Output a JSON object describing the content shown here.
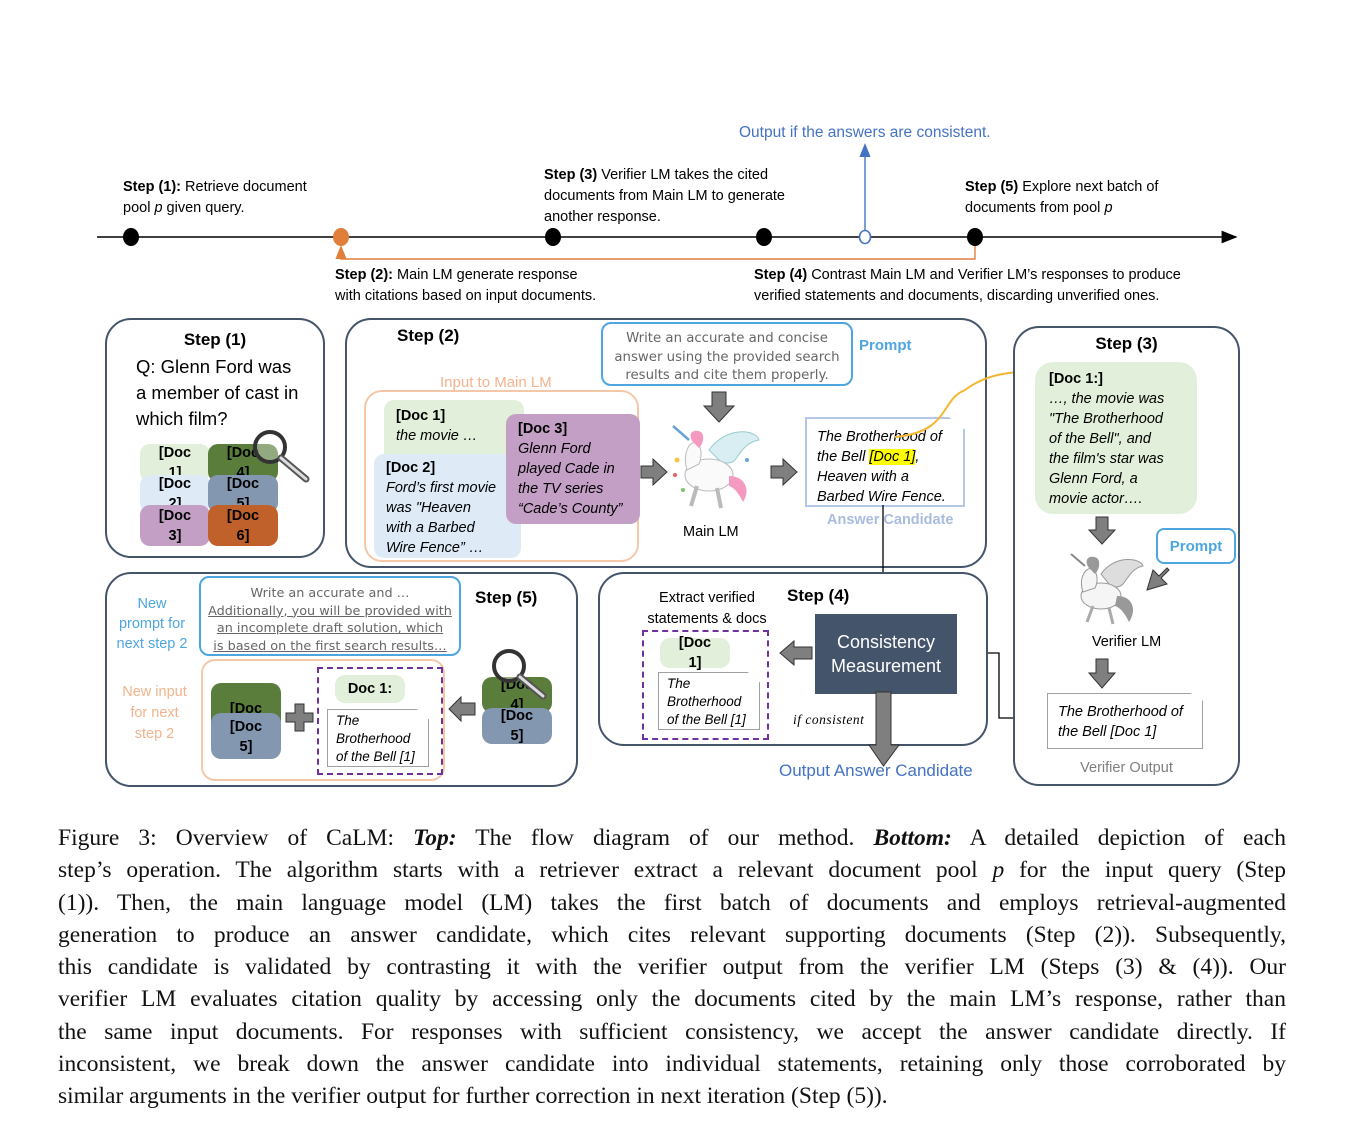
{
  "timeline": {
    "output_label": "Output if the answers are consistent.",
    "step1": {
      "bold": "Step (1):",
      "text": " Retrieve document",
      "line2a": "pool ",
      "line2p": "p",
      "line2b": " given query."
    },
    "step2": {
      "bold": "Step (2):",
      "text": " Main LM generate response",
      "line2": "with citations based on input documents."
    },
    "step3": {
      "bold": "Step (3)",
      "text": " Verifier LM takes the cited",
      "line2": "documents from Main LM to generate",
      "line3": "another response."
    },
    "step4": {
      "bold": "Step (4)",
      "text": " Contrast Main LM and Verifier LM’s responses to produce",
      "line2": "verified statements and documents, discarding unverified ones."
    },
    "step5": {
      "bold": "Step (5)",
      "text": " Explore next batch of",
      "line2a": "documents from pool ",
      "line2p": "p"
    },
    "colors": {
      "axis": "#000000",
      "step2_marker": "#e07f3c",
      "output_marker": "#4472c4",
      "feedback_line": "#e07f3c"
    }
  },
  "panel1": {
    "title": "Step (1)",
    "question": [
      "Q: Glenn Ford was",
      "a member of cast in",
      "which film?"
    ],
    "docs": [
      "[Doc 1]",
      "[Doc 2]",
      "[Doc 3]",
      "[Doc 4]",
      "[Doc 5]",
      "[Doc 6]"
    ],
    "doc_colors": [
      "#e2efda",
      "#deebf7",
      "#c39fc6",
      "#5a7d3c",
      "#8497b0",
      "#c0602a"
    ]
  },
  "panel2": {
    "title": "Step (2)",
    "input_label": "Input to Main LM",
    "doc1": {
      "tag": "[Doc 1]",
      "text": "the movie …"
    },
    "doc2": {
      "tag": "[Doc 2]",
      "lines": [
        "Ford’s first movie",
        "was \"Heaven",
        "with a Barbed",
        "Wire Fence” …"
      ]
    },
    "doc3": {
      "tag": "[Doc 3]",
      "lines": [
        "Glenn Ford",
        "played Cade in",
        "the TV series",
        "“Cade’s County”"
      ]
    },
    "prompt_lines": [
      "Write an accurate and concise",
      "answer using the provided search",
      "results and cite them properly."
    ],
    "prompt_label": "Prompt",
    "model_label": "Main LM",
    "answer": {
      "line1": "The Brotherhood of",
      "line2a": "the Bell ",
      "citation": "[Doc 1]",
      "line2b": ",",
      "line3": "Heaven with a",
      "line4": "Barbed Wire Fence."
    },
    "answer_label": "Answer Candidate"
  },
  "panel3": {
    "title": "Step (3)",
    "doc": {
      "tag": "[Doc 1:]",
      "lines": [
        "…, the movie was",
        "\"The Brotherhood",
        "of the Bell\", and",
        "the film's star was",
        "Glenn Ford, a",
        "movie actor…."
      ]
    },
    "prompt_label": "Prompt",
    "model_label": "Verifier LM",
    "output_lines": [
      "The Brotherhood of",
      "the Bell [Doc 1]"
    ],
    "output_label": "Verifier Output"
  },
  "panel4": {
    "title": "Step (4)",
    "extract_label": [
      "Extract verified",
      "statements & docs"
    ],
    "doc_tag": "[Doc 1]",
    "statement_lines": [
      "The",
      "Brotherhood",
      "of the Bell [1]"
    ],
    "measure_label": [
      "Consistency",
      "Measurement"
    ],
    "if_label": "if consistent",
    "output_label": "Output Answer Candidate"
  },
  "panel5": {
    "title": "Step (5)",
    "new_prompt_label": [
      "New",
      "prompt for",
      "next step 2"
    ],
    "prompt_lines": [
      "Write an accurate and …",
      "Additionally, you will be provided with",
      "an incomplete draft solution, which",
      "is based on the first search results…"
    ],
    "new_input_label": [
      "New input",
      "for next",
      "step 2"
    ],
    "docs_left": [
      "[Doc 4]",
      "[Doc 5]"
    ],
    "verified_tag": "Doc 1:",
    "verified_lines": [
      "The",
      "Brotherhood",
      "of the Bell [1]"
    ],
    "docs_right": [
      "[Doc 4]",
      "[Doc 5]"
    ]
  },
  "caption": {
    "lines": [
      [
        "Figure 3:  Overview of CaLM: ",
        "Top:",
        "  The flow diagram of our method.  ",
        "Bottom:",
        "  A detailed depiction of each"
      ],
      [
        "step’s operation. The algorithm starts with a retriever extract a relevant document pool ",
        "p",
        " for the input query (Step"
      ],
      [
        "(1)).  Then, the main language model (LM) takes the first batch of documents and employs retrieval-augmented"
      ],
      [
        "generation to produce an answer candidate, which cites relevant supporting documents (Step (2)). Subsequently,"
      ],
      [
        "this candidate is validated by contrasting it with the verifier output from the verifier LM (Steps (3) & (4)).  Our"
      ],
      [
        "verifier LM evaluates citation quality by accessing only the documents cited by the main LM’s response, rather than"
      ],
      [
        "the same input documents. For responses with sufficient consistency, we accept the answer candidate directly. If"
      ],
      [
        "inconsistent, we break down the answer candidate into individual statements, retaining only those corroborated by"
      ],
      [
        "similar arguments in the verifier output for further correction in next iteration (Step (5))."
      ]
    ]
  }
}
